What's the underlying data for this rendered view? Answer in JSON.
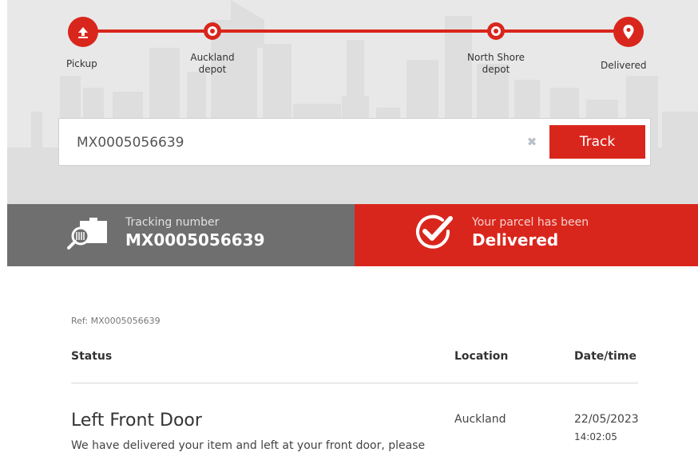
{
  "tracker": {
    "steps": [
      {
        "label": "Pickup",
        "icon": "upload-arrow-icon",
        "state": "completed"
      },
      {
        "label": "Auckland\ndepot",
        "icon": "step-dot",
        "state": "completed"
      },
      {
        "label": "North Shore\ndepot",
        "icon": "step-dot",
        "state": "completed"
      },
      {
        "label": "Delivered",
        "icon": "map-pin-icon",
        "state": "current"
      }
    ]
  },
  "search": {
    "value": "MX0005056639",
    "clear_icon": "close-icon",
    "track_label": "Track"
  },
  "banner": {
    "tracking_caption": "Tracking number",
    "tracking_number": "MX0005056639",
    "tracking_icon": "parcel-search-icon",
    "status_caption": "Your parcel has been",
    "status_value": "Delivered",
    "status_icon": "check-circle-icon"
  },
  "details": {
    "ref": "Ref: MX0005056639",
    "headers": {
      "status": "Status",
      "location": "Location",
      "datetime": "Date/time"
    },
    "events": [
      {
        "title": "Left Front Door",
        "description": "We have delivered your item and left at your front door, please",
        "location": "Auckland",
        "date": "22/05/2023",
        "time": "14:02:05"
      }
    ]
  },
  "colors": {
    "accent": "#d9261c",
    "banner_gray": "#6f6f6f",
    "hero_bg": "#e8e8e8"
  }
}
